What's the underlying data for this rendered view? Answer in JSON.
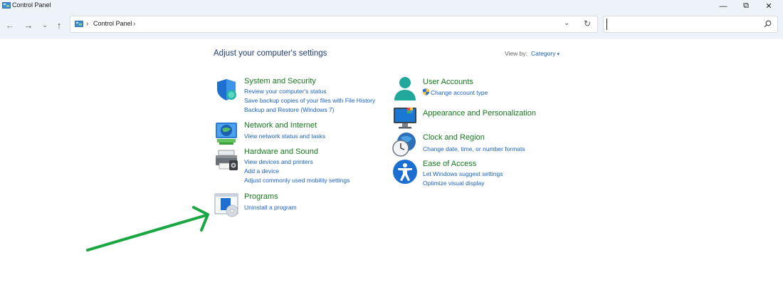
{
  "window": {
    "title": "Control Panel",
    "controls": {
      "minimize": "—",
      "maximize": "⧉",
      "close": "✕"
    }
  },
  "nav": {
    "back": "←",
    "forward": "→",
    "recent": "⌄",
    "up": "↑",
    "breadcrumb_root": "Control Panel",
    "separator": "›",
    "dropdown": "⌄",
    "refresh": "↻",
    "search_placeholder": ""
  },
  "content": {
    "heading": "Adjust your computer's settings",
    "view_by_label": "View by:",
    "view_by_value": "Category",
    "view_by_caret": "▾",
    "categories": [
      {
        "title": "System and Security",
        "icon": "shield-icon",
        "links": [
          "Review your computer's status",
          "Save backup copies of your files with File History",
          "Backup and Restore (Windows 7)"
        ]
      },
      {
        "title": "Network and Internet",
        "icon": "network-globe-icon",
        "links": [
          "View network status and tasks"
        ]
      },
      {
        "title": "Hardware and Sound",
        "icon": "printer-icon",
        "links": [
          "View devices and printers",
          "Add a device",
          "Adjust commonly used mobility settings"
        ]
      },
      {
        "title": "Programs",
        "icon": "programs-disc-icon",
        "links": [
          "Uninstall a program"
        ]
      },
      {
        "title": "User Accounts",
        "icon": "user-icon",
        "links": [
          "Change account type"
        ]
      },
      {
        "title": "Appearance and Personalization",
        "icon": "monitor-palette-icon",
        "links": []
      },
      {
        "title": "Clock and Region",
        "icon": "clock-globe-icon",
        "links": [
          "Change date, time, or number formats"
        ]
      },
      {
        "title": "Ease of Access",
        "icon": "accessibility-icon",
        "links": [
          "Let Windows suggest settings",
          "Optimize visual display"
        ]
      }
    ]
  },
  "colors": {
    "category_title": "#157a1e",
    "link": "#1a62c7",
    "heading": "#1e3a6e",
    "annotation_arrow": "#1aa640"
  }
}
